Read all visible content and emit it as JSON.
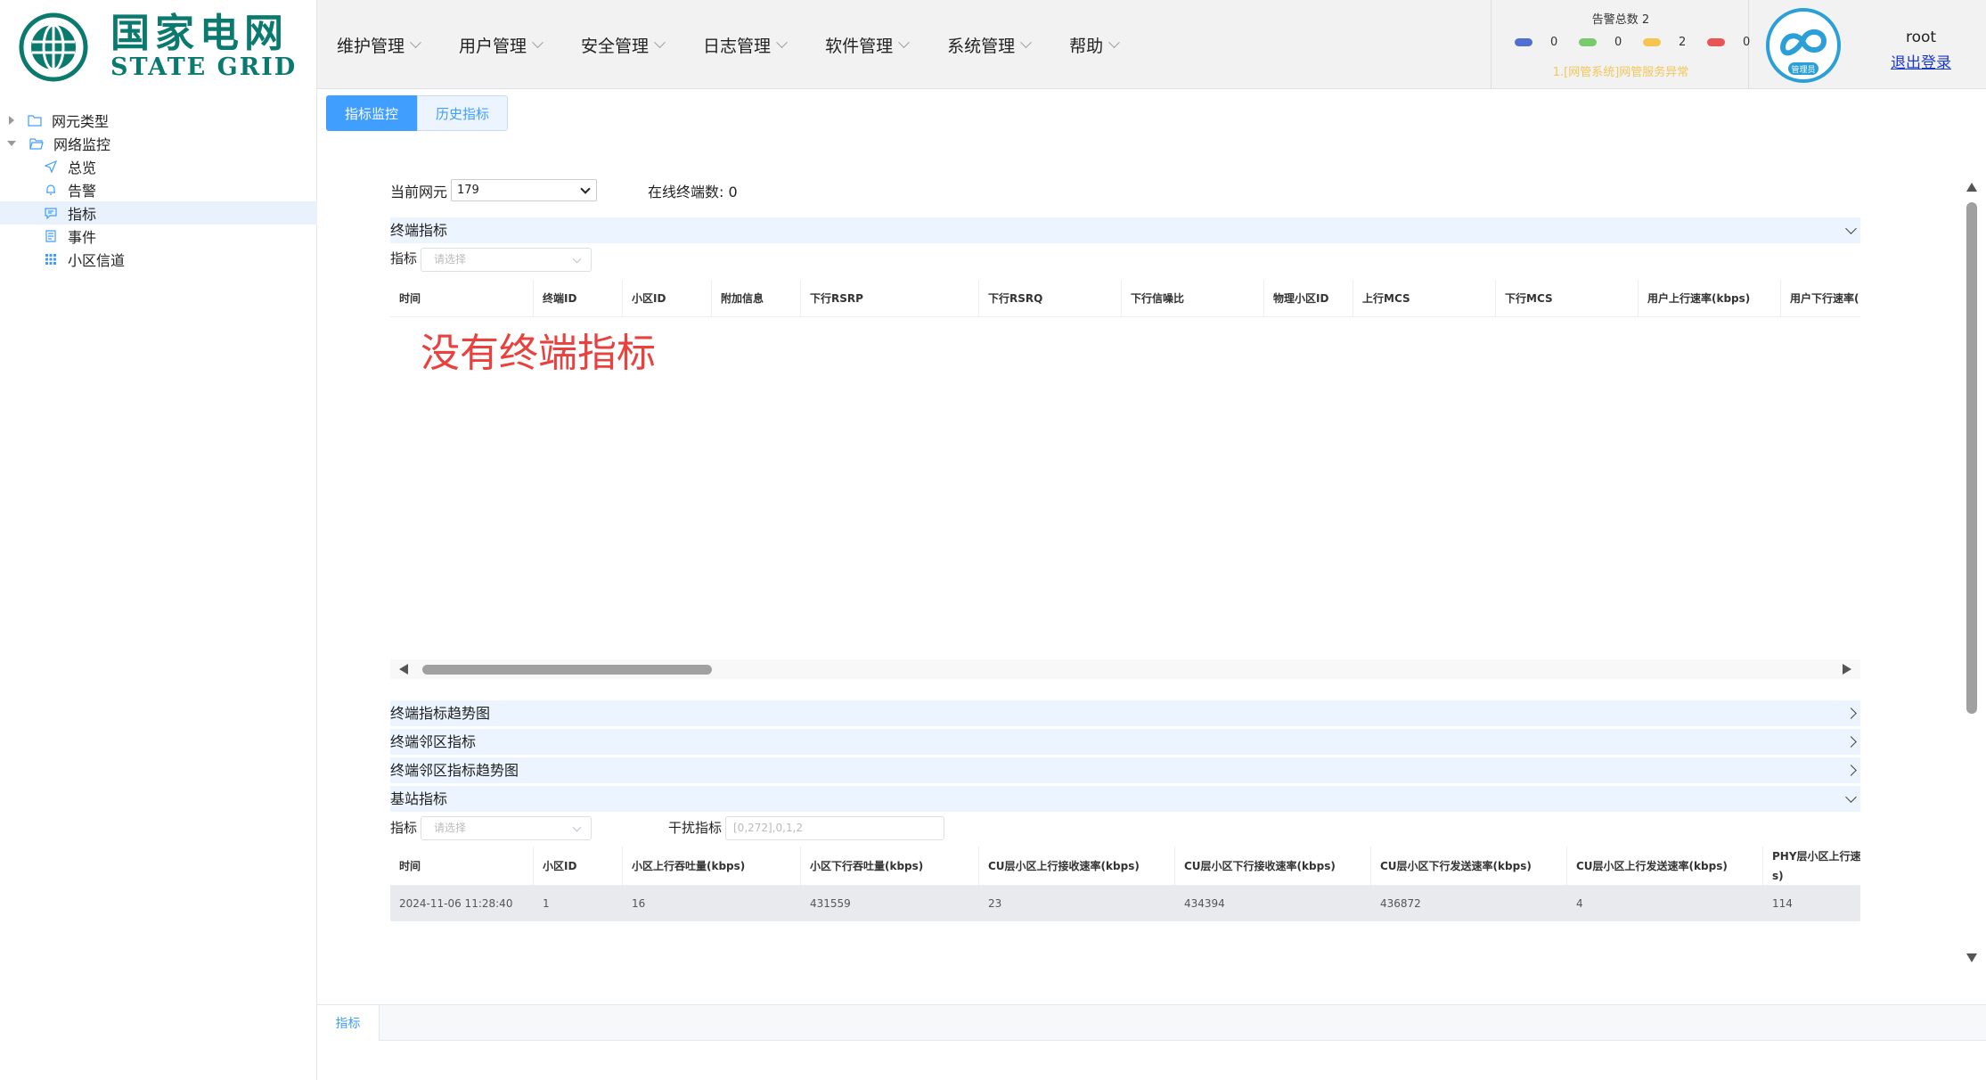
{
  "logo": {
    "cn": "国家电网",
    "en": "STATE GRID"
  },
  "menu": [
    {
      "label": "维护管理"
    },
    {
      "label": "用户管理"
    },
    {
      "label": "安全管理"
    },
    {
      "label": "日志管理"
    },
    {
      "label": "软件管理"
    },
    {
      "label": "系统管理"
    },
    {
      "label": "帮助"
    }
  ],
  "alarm": {
    "title": "告警总数 2",
    "counts": [
      {
        "color": "#4f6fd1",
        "value": "0"
      },
      {
        "color": "#7bc96f",
        "value": "0"
      },
      {
        "color": "#f5c451",
        "value": "2"
      },
      {
        "color": "#ea5455",
        "value": "0"
      }
    ],
    "message": "1.[网管系统]网管服务异常"
  },
  "user": {
    "badge": "管理员",
    "name": "root",
    "logout": "退出登录"
  },
  "sidebar": {
    "items": [
      {
        "label": "网元类型",
        "icon": "folder-icon"
      },
      {
        "label": "网络监控",
        "icon": "folder-icon"
      },
      {
        "label": "总览",
        "icon": "send-icon"
      },
      {
        "label": "告警",
        "icon": "bell-icon"
      },
      {
        "label": "指标",
        "icon": "chat-icon"
      },
      {
        "label": "事件",
        "icon": "document-icon"
      },
      {
        "label": "小区信道",
        "icon": "grid-icon"
      }
    ]
  },
  "tabs": [
    {
      "label": "指标监控"
    },
    {
      "label": "历史指标"
    }
  ],
  "controls": {
    "current_ne_label": "当前网元",
    "current_ne_value": "179",
    "online_label": "在线终端数: 0"
  },
  "terminal": {
    "section": "终端指标",
    "metric_label": "指标",
    "metric_placeholder": "请选择",
    "columns": [
      "时间",
      "终端ID",
      "小区ID",
      "附加信息",
      "下行RSRP",
      "下行RSRQ",
      "下行信噪比",
      "物理小区ID",
      "上行MCS",
      "下行MCS",
      "用户上行速率(kbps)",
      "用户下行速率("
    ],
    "empty": "没有终端指标"
  },
  "collapsed_sections": [
    {
      "label": "终端指标趋势图"
    },
    {
      "label": "终端邻区指标"
    },
    {
      "label": "终端邻区指标趋势图"
    }
  ],
  "base_station": {
    "section": "基站指标",
    "metric_label": "指标",
    "metric_placeholder": "请选择",
    "interference_label": "干扰指标",
    "interference_placeholder": "[0,272],0,1,2",
    "columns": [
      "时间",
      "小区ID",
      "小区上行吞吐量(kbps)",
      "小区下行吞吐量(kbps)",
      "CU层小区上行接收速率(kbps)",
      "CU层小区下行接收速率(kbps)",
      "CU层小区下行发送速率(kbps)",
      "CU层小区上行发送速率(kbps)",
      "PHY层小区上行速",
      "s)"
    ],
    "rows": [
      [
        "2024-11-06 11:28:40",
        "1",
        "16",
        "431559",
        "23",
        "434394",
        "436872",
        "4",
        "114"
      ]
    ]
  },
  "bottom_tab": {
    "label": "指标"
  }
}
